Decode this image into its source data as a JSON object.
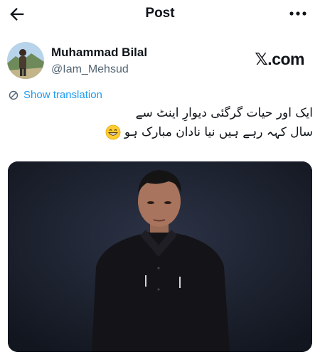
{
  "header": {
    "title": "Post",
    "back_icon": "arrow-left-icon",
    "more_icon": "more-horizontal-icon"
  },
  "author": {
    "name": "Muhammad Bilal",
    "handle": "@Iam_Mehsud",
    "avatar_icon": "user-avatar"
  },
  "source_logo": "𝕏.com",
  "translation": {
    "label": "Show translation",
    "icon": "globe-icon"
  },
  "tweet": {
    "line1": "ایک اور حیات گرگئی دیوارِ اینٹ سے",
    "line2": "سال کہہ رہے ہیں نیا نادان مبارک ہو",
    "emoji": "grinning-face-emoji"
  },
  "media": {
    "type": "video-still",
    "background_color": "#1b2030"
  },
  "colors": {
    "link": "#1d9bf0",
    "text_primary": "#0f1419",
    "text_secondary": "#536471"
  }
}
